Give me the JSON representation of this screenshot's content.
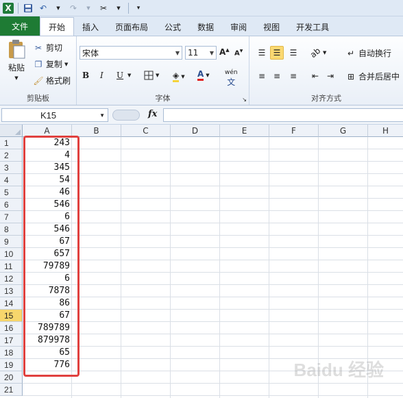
{
  "qat": {
    "app_logo": "X"
  },
  "tabs": [
    "文件",
    "开始",
    "插入",
    "页面布局",
    "公式",
    "数据",
    "审阅",
    "视图",
    "开发工具"
  ],
  "clipboard": {
    "paste": "粘贴",
    "cut": "剪切",
    "copy": "复制",
    "format_painter": "格式刷",
    "label": "剪贴板"
  },
  "font": {
    "name": "宋体",
    "size": "11",
    "bold": "B",
    "italic": "I",
    "underline": "U",
    "font_color": "A",
    "phonetic": "wén",
    "label": "字体"
  },
  "alignment": {
    "wrap": "自动换行",
    "merge": "合并后居中",
    "label": "对齐方式"
  },
  "formula_bar": {
    "name_box": "K15",
    "fx": "fx"
  },
  "columns": [
    "A",
    "B",
    "C",
    "D",
    "E",
    "F",
    "G",
    "H"
  ],
  "rows": [
    "1",
    "2",
    "3",
    "4",
    "5",
    "6",
    "7",
    "8",
    "9",
    "10",
    "11",
    "12",
    "13",
    "14",
    "15",
    "16",
    "17",
    "18",
    "19",
    "20",
    "21"
  ],
  "selected_row": "15",
  "cells_A": [
    "243",
    "4",
    "345",
    "54",
    "46",
    "546",
    "6",
    "546",
    "67",
    "657",
    "79789",
    "6",
    "7878",
    "86",
    "67",
    "789789",
    "879978",
    "65",
    "776"
  ],
  "watermark": "Baidu 经验",
  "colors": {
    "file_tab": "#1e7b34",
    "highlight_box": "#e0413f",
    "selected_row_header": "#f7d66c"
  }
}
